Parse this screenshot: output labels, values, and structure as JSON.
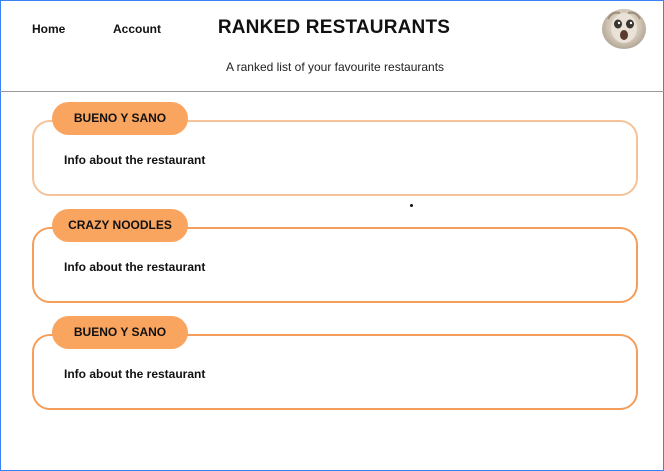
{
  "nav": {
    "home": "Home",
    "account": "Account"
  },
  "header": {
    "title": "RANKED RESTAURANTS",
    "subtitle": "A ranked list of your favourite restaurants"
  },
  "restaurants": [
    {
      "name": "BUENO Y SANO",
      "info": "Info about the restaurant"
    },
    {
      "name": "CRAZY NOODLES",
      "info": "Info about the restaurant"
    },
    {
      "name": "BUENO Y SANO",
      "info": "Info about the restaurant"
    }
  ],
  "colors": {
    "accent": "#f9a45f",
    "card_border": "#f59e5b",
    "card_border_light": "#f5c39a",
    "frame": "#3b82f6"
  },
  "icons": {
    "avatar": "profile-avatar"
  }
}
